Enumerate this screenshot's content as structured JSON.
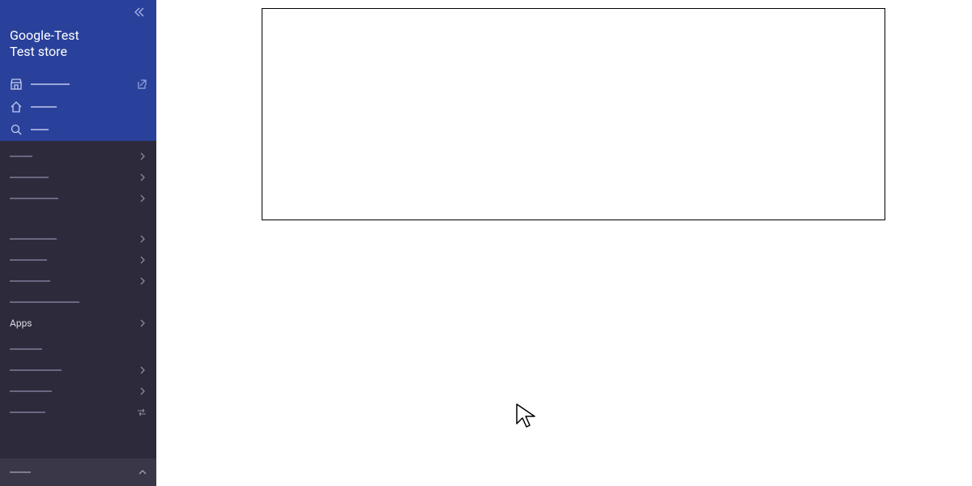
{
  "sidebar": {
    "store_line1": "Google-Test",
    "store_line2": "Test store",
    "topIcons": [
      {
        "name": "storefront-icon",
        "lineWidth": 48,
        "hasExternal": true
      },
      {
        "name": "home-icon",
        "lineWidth": 32,
        "hasExternal": false
      },
      {
        "name": "search-icon",
        "lineWidth": 22,
        "hasExternal": false
      }
    ],
    "navGroup1": [
      {
        "lineWidth": 28,
        "hasChevron": true
      },
      {
        "lineWidth": 48,
        "hasChevron": true
      },
      {
        "lineWidth": 60,
        "hasChevron": true
      }
    ],
    "navGroup2": [
      {
        "lineWidth": 58,
        "hasChevron": true
      },
      {
        "lineWidth": 46,
        "hasChevron": true
      },
      {
        "lineWidth": 50,
        "hasChevron": true
      },
      {
        "lineWidth": 86,
        "hasChevron": false
      }
    ],
    "appsLabel": "Apps",
    "navGroup3": [
      {
        "lineWidth": 40,
        "hasChevron": false
      },
      {
        "lineWidth": 64,
        "hasChevron": true
      },
      {
        "lineWidth": 52,
        "hasChevron": true
      },
      {
        "lineWidth": 44,
        "hasChevron": false,
        "hasSwap": true
      }
    ],
    "bottom": {
      "lineWidth": 26
    }
  }
}
